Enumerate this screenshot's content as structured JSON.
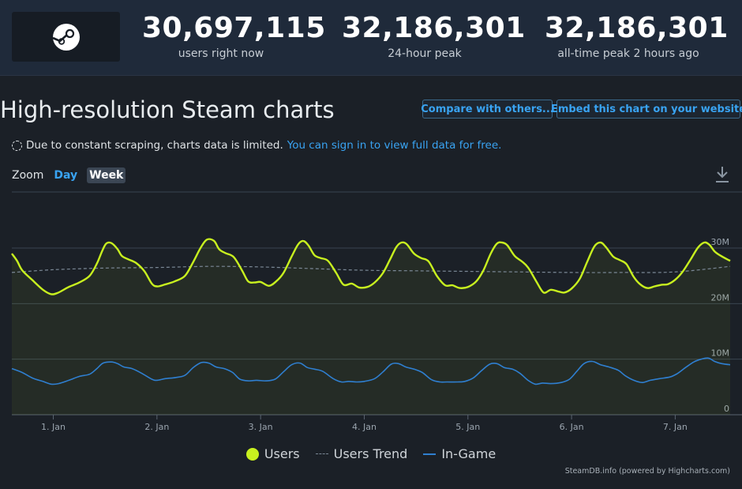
{
  "header": {
    "stats": [
      {
        "value": "30,697,115",
        "label": "users right now"
      },
      {
        "value": "32,186,301",
        "label": "24-hour peak"
      },
      {
        "value": "32,186,301",
        "label": "all-time peak 2 hours ago"
      }
    ],
    "logo_icon": "steam-logo-icon"
  },
  "page": {
    "title": "High-resolution Steam charts",
    "compare_button": "Compare with others...",
    "embed_button": "Embed this chart on your website",
    "notice_text": "Due to constant scraping, charts data is limited.",
    "notice_link": "You can sign in to view full data for free."
  },
  "zoom": {
    "label": "Zoom",
    "options": [
      "Day",
      "Week"
    ],
    "active": "Week",
    "download_icon": "download-icon"
  },
  "legend": {
    "users": "Users",
    "trend": "Users Trend",
    "ingame": "In-Game"
  },
  "credits": "SteamDB.info (powered by Highcharts.com)",
  "colors": {
    "users": "#c8f01f",
    "trend": "#7b8896",
    "ingame": "#2f7fd0",
    "accent": "#39a3f2"
  },
  "chart_data": {
    "type": "line",
    "x_unit": "days since Dec 31",
    "xlim": [
      0.6,
      7.53
    ],
    "ylim": [
      0,
      30000000
    ],
    "y_ticks": [
      {
        "value": 0,
        "label": "0"
      },
      {
        "value": 10000000,
        "label": "10M"
      },
      {
        "value": 20000000,
        "label": "20M"
      },
      {
        "value": 30000000,
        "label": "30M"
      }
    ],
    "x_ticks": [
      {
        "value": 1,
        "label": "1. Jan"
      },
      {
        "value": 2,
        "label": "2. Jan"
      },
      {
        "value": 3,
        "label": "3. Jan"
      },
      {
        "value": 4,
        "label": "4. Jan"
      },
      {
        "value": 5,
        "label": "5. Jan"
      },
      {
        "value": 6,
        "label": "6. Jan"
      },
      {
        "value": 7,
        "label": "7. Jan"
      }
    ],
    "series": [
      {
        "name": "Users",
        "points": [
          [
            0.6,
            29.0
          ],
          [
            0.65,
            27.7
          ],
          [
            0.7,
            26.0
          ],
          [
            0.8,
            24.2
          ],
          [
            0.9,
            22.5
          ],
          [
            0.98,
            21.7
          ],
          [
            1.05,
            22.0
          ],
          [
            1.15,
            23.0
          ],
          [
            1.25,
            23.8
          ],
          [
            1.35,
            25.0
          ],
          [
            1.42,
            27.2
          ],
          [
            1.47,
            29.4
          ],
          [
            1.51,
            30.8
          ],
          [
            1.56,
            30.9
          ],
          [
            1.62,
            29.8
          ],
          [
            1.66,
            28.6
          ],
          [
            1.72,
            28.0
          ],
          [
            1.8,
            27.3
          ],
          [
            1.88,
            25.8
          ],
          [
            1.95,
            23.6
          ],
          [
            2.0,
            23.1
          ],
          [
            2.07,
            23.4
          ],
          [
            2.17,
            24.0
          ],
          [
            2.27,
            25.0
          ],
          [
            2.35,
            27.5
          ],
          [
            2.42,
            30.0
          ],
          [
            2.48,
            31.5
          ],
          [
            2.55,
            31.3
          ],
          [
            2.6,
            29.8
          ],
          [
            2.66,
            29.1
          ],
          [
            2.74,
            28.4
          ],
          [
            2.82,
            26.0
          ],
          [
            2.88,
            24.0
          ],
          [
            2.94,
            23.8
          ],
          [
            3.0,
            23.9
          ],
          [
            3.08,
            23.2
          ],
          [
            3.15,
            24.0
          ],
          [
            3.22,
            25.5
          ],
          [
            3.3,
            28.5
          ],
          [
            3.36,
            30.6
          ],
          [
            3.41,
            31.3
          ],
          [
            3.46,
            30.5
          ],
          [
            3.52,
            28.7
          ],
          [
            3.58,
            28.2
          ],
          [
            3.65,
            27.7
          ],
          [
            3.73,
            25.5
          ],
          [
            3.8,
            23.4
          ],
          [
            3.88,
            23.6
          ],
          [
            3.95,
            22.9
          ],
          [
            4.03,
            23.0
          ],
          [
            4.1,
            23.8
          ],
          [
            4.18,
            25.5
          ],
          [
            4.25,
            28.0
          ],
          [
            4.31,
            30.2
          ],
          [
            4.36,
            31.0
          ],
          [
            4.41,
            30.7
          ],
          [
            4.48,
            29.0
          ],
          [
            4.55,
            28.2
          ],
          [
            4.62,
            27.6
          ],
          [
            4.7,
            25.0
          ],
          [
            4.78,
            23.3
          ],
          [
            4.85,
            23.3
          ],
          [
            4.92,
            22.8
          ],
          [
            5.0,
            23.0
          ],
          [
            5.08,
            24.0
          ],
          [
            5.15,
            26.0
          ],
          [
            5.22,
            29.0
          ],
          [
            5.28,
            30.8
          ],
          [
            5.33,
            31.0
          ],
          [
            5.38,
            30.5
          ],
          [
            5.45,
            28.6
          ],
          [
            5.52,
            27.6
          ],
          [
            5.58,
            26.5
          ],
          [
            5.66,
            24.0
          ],
          [
            5.73,
            22.0
          ],
          [
            5.8,
            22.5
          ],
          [
            5.87,
            22.2
          ],
          [
            5.93,
            22.0
          ],
          [
            6.0,
            22.7
          ],
          [
            6.08,
            24.5
          ],
          [
            6.15,
            27.5
          ],
          [
            6.22,
            30.3
          ],
          [
            6.28,
            31.0
          ],
          [
            6.33,
            30.2
          ],
          [
            6.4,
            28.5
          ],
          [
            6.47,
            27.8
          ],
          [
            6.53,
            27.1
          ],
          [
            6.6,
            24.8
          ],
          [
            6.66,
            23.5
          ],
          [
            6.73,
            22.8
          ],
          [
            6.8,
            23.1
          ],
          [
            6.87,
            23.4
          ],
          [
            6.93,
            23.5
          ],
          [
            7.0,
            24.3
          ],
          [
            7.07,
            25.7
          ],
          [
            7.15,
            28.0
          ],
          [
            7.22,
            30.1
          ],
          [
            7.28,
            31.0
          ],
          [
            7.33,
            30.6
          ],
          [
            7.38,
            29.4
          ],
          [
            7.44,
            28.6
          ],
          [
            7.52,
            27.8
          ],
          [
            7.53,
            27.7
          ]
        ]
      },
      {
        "name": "Users Trend",
        "points": [
          [
            0.6,
            25.6
          ],
          [
            1.0,
            26.1
          ],
          [
            1.5,
            26.4
          ],
          [
            2.0,
            26.5
          ],
          [
            2.5,
            26.7
          ],
          [
            3.0,
            26.6
          ],
          [
            3.5,
            26.3
          ],
          [
            4.0,
            26.0
          ],
          [
            4.5,
            25.9
          ],
          [
            5.0,
            25.8
          ],
          [
            5.5,
            25.7
          ],
          [
            6.0,
            25.6
          ],
          [
            6.5,
            25.6
          ],
          [
            7.0,
            25.7
          ],
          [
            7.53,
            26.7
          ]
        ]
      },
      {
        "name": "In-Game",
        "points": [
          [
            0.6,
            8.3
          ],
          [
            0.7,
            7.6
          ],
          [
            0.8,
            6.6
          ],
          [
            0.9,
            6.0
          ],
          [
            0.98,
            5.5
          ],
          [
            1.05,
            5.6
          ],
          [
            1.15,
            6.2
          ],
          [
            1.25,
            6.9
          ],
          [
            1.35,
            7.3
          ],
          [
            1.42,
            8.3
          ],
          [
            1.48,
            9.3
          ],
          [
            1.56,
            9.5
          ],
          [
            1.62,
            9.2
          ],
          [
            1.68,
            8.6
          ],
          [
            1.76,
            8.3
          ],
          [
            1.85,
            7.5
          ],
          [
            1.95,
            6.4
          ],
          [
            2.0,
            6.2
          ],
          [
            2.08,
            6.5
          ],
          [
            2.18,
            6.7
          ],
          [
            2.27,
            7.1
          ],
          [
            2.35,
            8.5
          ],
          [
            2.43,
            9.4
          ],
          [
            2.5,
            9.3
          ],
          [
            2.57,
            8.6
          ],
          [
            2.65,
            8.3
          ],
          [
            2.73,
            7.6
          ],
          [
            2.8,
            6.4
          ],
          [
            2.88,
            6.1
          ],
          [
            2.96,
            6.2
          ],
          [
            3.05,
            6.1
          ],
          [
            3.14,
            6.4
          ],
          [
            3.22,
            7.7
          ],
          [
            3.3,
            9.0
          ],
          [
            3.38,
            9.3
          ],
          [
            3.45,
            8.5
          ],
          [
            3.52,
            8.2
          ],
          [
            3.6,
            7.8
          ],
          [
            3.7,
            6.5
          ],
          [
            3.78,
            5.9
          ],
          [
            3.85,
            6.0
          ],
          [
            3.93,
            5.9
          ],
          [
            4.0,
            6.0
          ],
          [
            4.1,
            6.5
          ],
          [
            4.18,
            7.7
          ],
          [
            4.26,
            9.1
          ],
          [
            4.33,
            9.2
          ],
          [
            4.4,
            8.6
          ],
          [
            4.48,
            8.2
          ],
          [
            4.56,
            7.6
          ],
          [
            4.65,
            6.3
          ],
          [
            4.73,
            5.9
          ],
          [
            4.8,
            5.9
          ],
          [
            4.9,
            5.9
          ],
          [
            4.97,
            6.0
          ],
          [
            5.05,
            6.6
          ],
          [
            5.13,
            7.9
          ],
          [
            5.21,
            9.1
          ],
          [
            5.28,
            9.2
          ],
          [
            5.35,
            8.5
          ],
          [
            5.43,
            8.2
          ],
          [
            5.5,
            7.5
          ],
          [
            5.58,
            6.2
          ],
          [
            5.65,
            5.5
          ],
          [
            5.72,
            5.7
          ],
          [
            5.8,
            5.6
          ],
          [
            5.9,
            5.8
          ],
          [
            5.98,
            6.4
          ],
          [
            6.05,
            7.8
          ],
          [
            6.12,
            9.2
          ],
          [
            6.2,
            9.6
          ],
          [
            6.28,
            9.0
          ],
          [
            6.36,
            8.6
          ],
          [
            6.45,
            8.0
          ],
          [
            6.52,
            7.0
          ],
          [
            6.6,
            6.2
          ],
          [
            6.68,
            5.8
          ],
          [
            6.76,
            6.2
          ],
          [
            6.85,
            6.5
          ],
          [
            6.95,
            6.8
          ],
          [
            7.02,
            7.4
          ],
          [
            7.1,
            8.5
          ],
          [
            7.18,
            9.5
          ],
          [
            7.25,
            10.0
          ],
          [
            7.32,
            10.2
          ],
          [
            7.38,
            9.6
          ],
          [
            7.45,
            9.2
          ],
          [
            7.53,
            9.0
          ]
        ]
      }
    ]
  }
}
